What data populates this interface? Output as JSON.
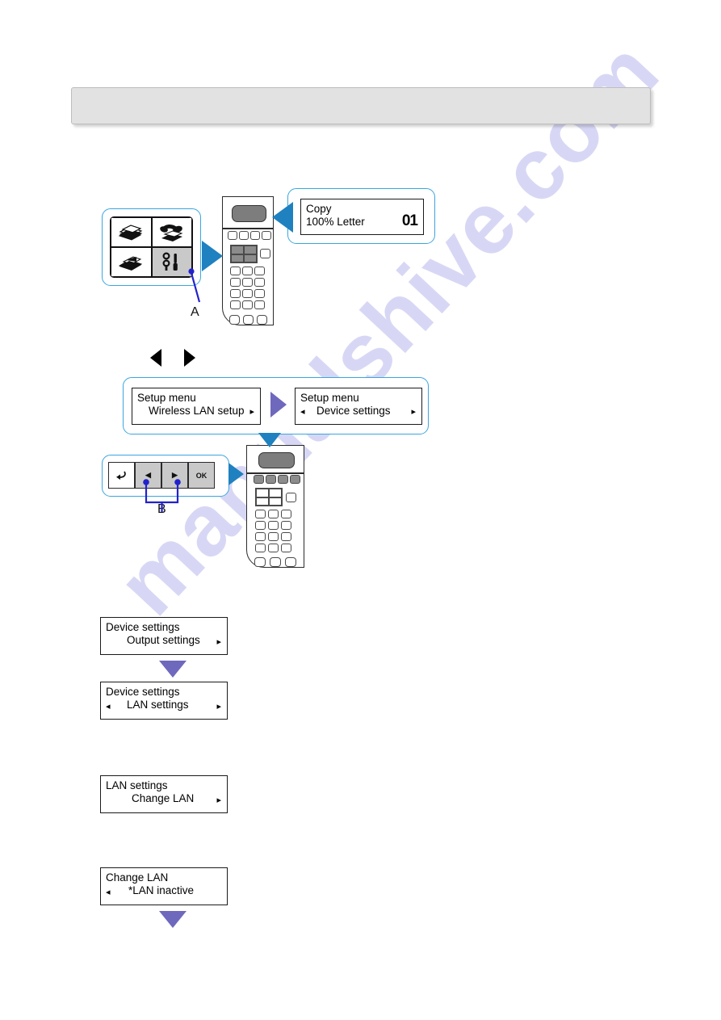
{
  "page": {
    "watermark": "manualshive.com",
    "header_bar_text": ""
  },
  "colors": {
    "callout_border": "#3aa6de",
    "blue_arrow": "#1f81bf",
    "purple_arrow": "#6e69bd",
    "leader_line": "#2222cc",
    "header_bar_fill": "#e2e2e2",
    "selected_tile": "#c9c9c9",
    "lcd_panel": "#7d7d7d"
  },
  "step1": {
    "callout_label": "A",
    "icon_tiles": [
      {
        "name": "copy-icon",
        "label": "Copy",
        "selected": false
      },
      {
        "name": "fax-icon",
        "label": "Fax",
        "selected": false
      },
      {
        "name": "scan-icon",
        "label": "Scan",
        "selected": false
      },
      {
        "name": "setup-icon",
        "label": "Setup",
        "selected": true
      }
    ],
    "lcd": {
      "line1": "Copy",
      "line2": "100% Letter",
      "copies": "01"
    }
  },
  "step2": {
    "nav_hint_left_icon": "triangle-left-icon",
    "nav_hint_right_icon": "triangle-right-icon",
    "screens": [
      {
        "line1": "Setup menu",
        "line2": "Wireless LAN setup",
        "left_arrow": false,
        "right_arrow": true
      },
      {
        "line1": "Setup menu",
        "line2": "Device settings",
        "left_arrow": true,
        "right_arrow": true
      }
    ],
    "callout_label": "B",
    "buttons": [
      {
        "name": "back-button",
        "glyph": "↶"
      },
      {
        "name": "left-arrow-button",
        "glyph": "◀",
        "highlighted": true
      },
      {
        "name": "right-arrow-button",
        "glyph": "▶",
        "highlighted": true
      },
      {
        "name": "ok-button",
        "glyph": "OK"
      }
    ]
  },
  "step3": {
    "screens": [
      {
        "line1": "Device settings",
        "line2": "Output settings",
        "left_arrow": false,
        "right_arrow": true
      },
      {
        "line1": "Device settings",
        "line2": "LAN settings",
        "left_arrow": true,
        "right_arrow": true
      }
    ]
  },
  "step4": {
    "screens": [
      {
        "line1": "LAN settings",
        "line2": "Change LAN",
        "left_arrow": false,
        "right_arrow": true
      }
    ]
  },
  "step5": {
    "screens": [
      {
        "line1": "Change LAN",
        "line2": "*LAN inactive",
        "left_arrow": true,
        "right_arrow": false
      }
    ]
  }
}
